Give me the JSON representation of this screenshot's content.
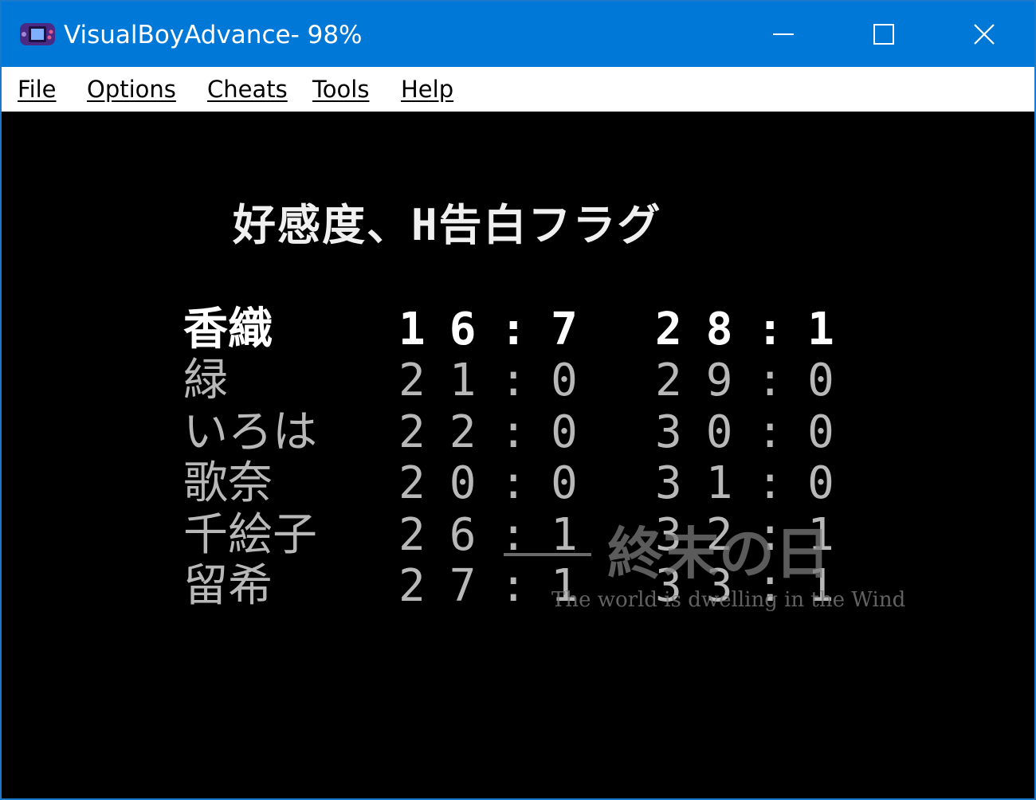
{
  "window": {
    "title": "VisualBoyAdvance- 98%",
    "icon": "gba-icon",
    "accent_color": "#0078d7"
  },
  "menu": {
    "items": [
      {
        "label": "File",
        "icon": null
      },
      {
        "label": "Options",
        "icon": null
      },
      {
        "label": "Cheats",
        "icon": null
      },
      {
        "label": "Tools",
        "icon": null
      },
      {
        "label": "Help",
        "icon": null
      }
    ]
  },
  "game": {
    "title": "好感度、H告白フラグ",
    "rows": [
      {
        "name": "香織",
        "a": "16:7",
        "b": "28:1",
        "selected": true
      },
      {
        "name": "緑",
        "a": "21:0",
        "b": "29:0",
        "selected": false
      },
      {
        "name": "いろは",
        "a": "22:0",
        "b": "30:0",
        "selected": false
      },
      {
        "name": "歌奈",
        "a": "20:0",
        "b": "31:0",
        "selected": false
      },
      {
        "name": "千絵子",
        "a": "26:1",
        "b": "32:1",
        "selected": false
      },
      {
        "name": "留希",
        "a": "27:1",
        "b": "33:1",
        "selected": false
      }
    ],
    "watermark": {
      "main": "終末の日",
      "sub": "The world is dwelling in the Wind"
    }
  }
}
